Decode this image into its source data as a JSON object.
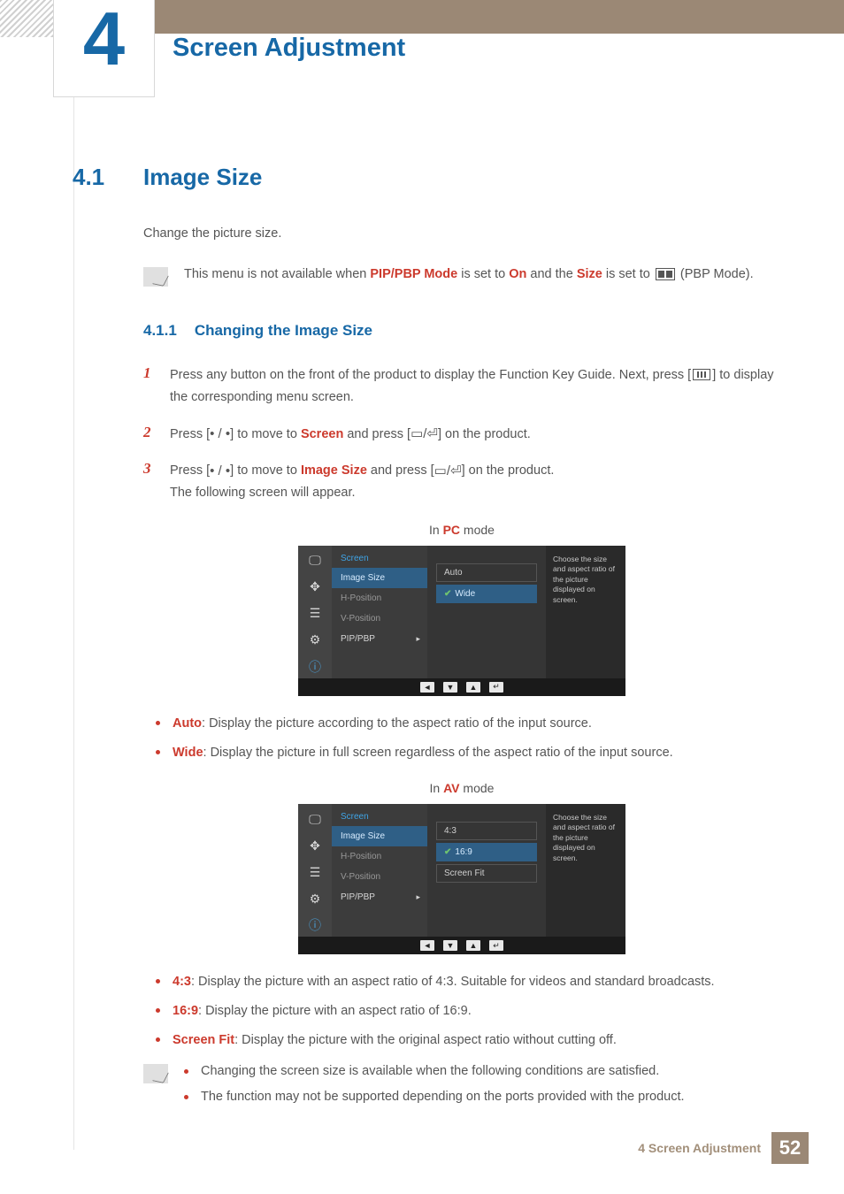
{
  "chapter": {
    "number": "4",
    "title": "Screen Adjustment"
  },
  "section": {
    "number": "4.1",
    "title": "Image Size",
    "intro": "Change the picture size."
  },
  "note1": {
    "pre": "This menu is not available when ",
    "k1": "PIP/PBP Mode",
    "mid1": " is set to ",
    "k2": "On",
    "mid2": " and the ",
    "k3": "Size",
    "mid3": " is set to ",
    "post": " (PBP Mode)."
  },
  "subsection": {
    "number": "4.1.1",
    "title": "Changing the Image Size"
  },
  "steps": {
    "s1": {
      "n": "1",
      "a": "Press any button on the front of the product to display the Function Key Guide. Next, press [",
      "b": "] to display the corresponding menu screen."
    },
    "s2": {
      "n": "2",
      "a": "Press [",
      "b": "] to move to ",
      "k": "Screen",
      "c": " and press [",
      "d": "] on the product."
    },
    "s3": {
      "n": "3",
      "a": "Press [",
      "b": "] to move to ",
      "k": "Image Size",
      "c": " and press [",
      "d": "] on the product.",
      "e": "The following screen will appear."
    }
  },
  "mode_pc_label_pre": "In ",
  "mode_pc_label_key": "PC",
  "mode_pc_label_post": " mode",
  "mode_av_label_pre": "In ",
  "mode_av_label_key": "AV",
  "mode_av_label_post": " mode",
  "osd_pc": {
    "header": "Screen",
    "menu": [
      "Image Size",
      "H-Position",
      "V-Position",
      "PIP/PBP"
    ],
    "options": [
      "Auto",
      "Wide"
    ],
    "selected_option_index": 1,
    "help": "Choose the size and aspect ratio of the picture displayed on screen."
  },
  "osd_av": {
    "header": "Screen",
    "menu": [
      "Image Size",
      "H-Position",
      "V-Position",
      "PIP/PBP"
    ],
    "options": [
      "4:3",
      "16:9",
      "Screen Fit"
    ],
    "selected_option_index": 1,
    "help": "Choose the size and aspect ratio of the picture displayed on screen."
  },
  "pc_bullets": {
    "b1": {
      "k": "Auto",
      "t": ": Display the picture according to the aspect ratio of the input source."
    },
    "b2": {
      "k": "Wide",
      "t": ": Display the picture in full screen regardless of the aspect ratio of the input source."
    }
  },
  "av_bullets": {
    "b1": {
      "k": "4:3",
      "t": ": Display the picture with an aspect ratio of 4:3. Suitable for videos and standard broadcasts."
    },
    "b2": {
      "k": "16:9",
      "t": ": Display the picture with an aspect ratio of 16:9."
    },
    "b3": {
      "k": "Screen Fit",
      "t": ": Display the picture with the original aspect ratio without cutting off."
    }
  },
  "note2": {
    "b1": "Changing the screen size is available when the following conditions are satisfied.",
    "b2": "The function may not be supported depending on the ports provided with the product."
  },
  "footer": {
    "text": "4 Screen Adjustment",
    "page": "52"
  },
  "glyphs": {
    "dotslash": " • / • ",
    "enterpair": "▭/⏎"
  }
}
